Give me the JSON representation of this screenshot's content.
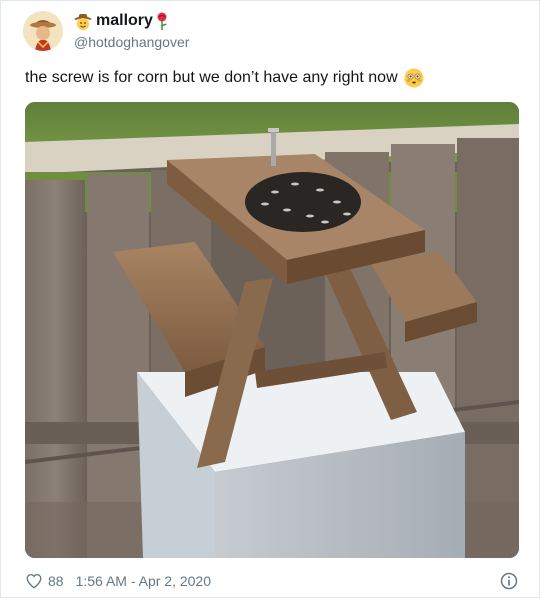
{
  "tweet": {
    "author": {
      "display_name": "mallory",
      "handle": "@hotdoghangover",
      "prefix_emoji": "cowboy-hat-face-icon",
      "suffix_emoji": "rose-icon"
    },
    "text": "the screw is for corn but we don’t have any right now",
    "text_emoji": "flushed-face-icon",
    "photo": {
      "subject": "squirrel-picnic-table-feeder-photo"
    },
    "footer": {
      "like_count": "88",
      "timestamp": "1:56 AM - Apr 2, 2020",
      "like_icon": "heart-icon",
      "info_icon": "info-icon"
    }
  },
  "colors": {
    "text_primary": "#14171a",
    "text_secondary": "#657786",
    "border": "#e1e8ed"
  }
}
